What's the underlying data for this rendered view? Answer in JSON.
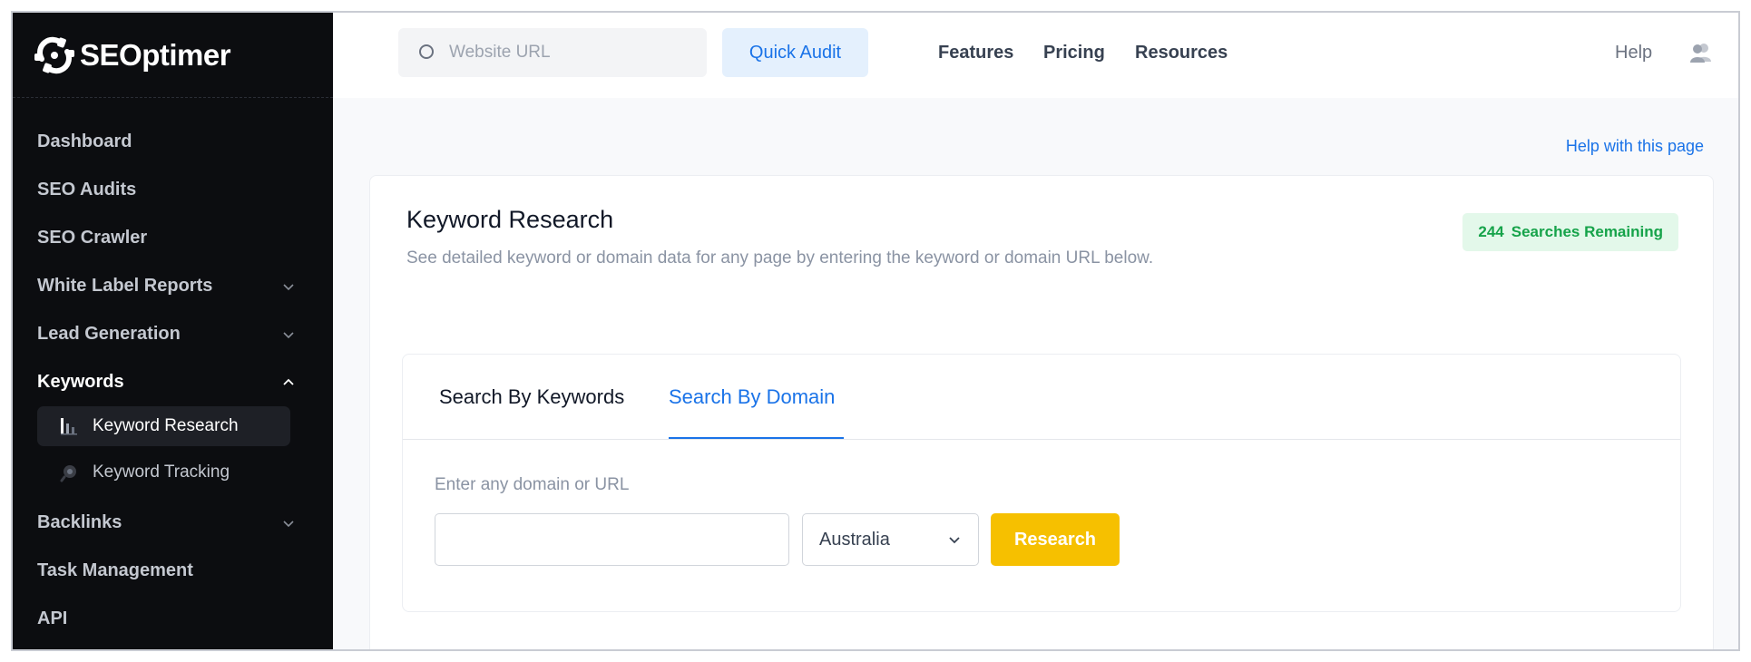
{
  "app": {
    "logo_text": "SEOptimer"
  },
  "topbar": {
    "search_placeholder": "Website URL",
    "quick_audit_label": "Quick Audit",
    "links": [
      "Features",
      "Pricing",
      "Resources"
    ],
    "help_label": "Help"
  },
  "sidebar": {
    "items": [
      {
        "label": "Dashboard"
      },
      {
        "label": "SEO Audits"
      },
      {
        "label": "SEO Crawler"
      },
      {
        "label": "White Label Reports"
      },
      {
        "label": "Lead Generation"
      },
      {
        "label": "Keywords"
      },
      {
        "label": "Backlinks"
      },
      {
        "label": "Task Management"
      },
      {
        "label": "API"
      }
    ],
    "sub_items": [
      {
        "label": "Keyword Research"
      },
      {
        "label": "Keyword Tracking"
      }
    ]
  },
  "main": {
    "help_page_label": "Help with this page",
    "title": "Keyword Research",
    "subtitle": "See detailed keyword or domain data for any page by entering the keyword or domain URL below.",
    "badge": {
      "count": "244",
      "label": "Searches Remaining"
    },
    "tabs": [
      {
        "label": "Search By Keywords"
      },
      {
        "label": "Search By Domain"
      }
    ],
    "field_label": "Enter any domain or URL",
    "domain_value": "",
    "country_selected": "Australia",
    "research_label": "Research"
  },
  "colors": {
    "accent": "#1a73e8",
    "sidebar_bg": "#0c0d10",
    "research_button": "#f6c000",
    "badge_bg": "#e3f8ea",
    "badge_text": "#16a34a"
  }
}
